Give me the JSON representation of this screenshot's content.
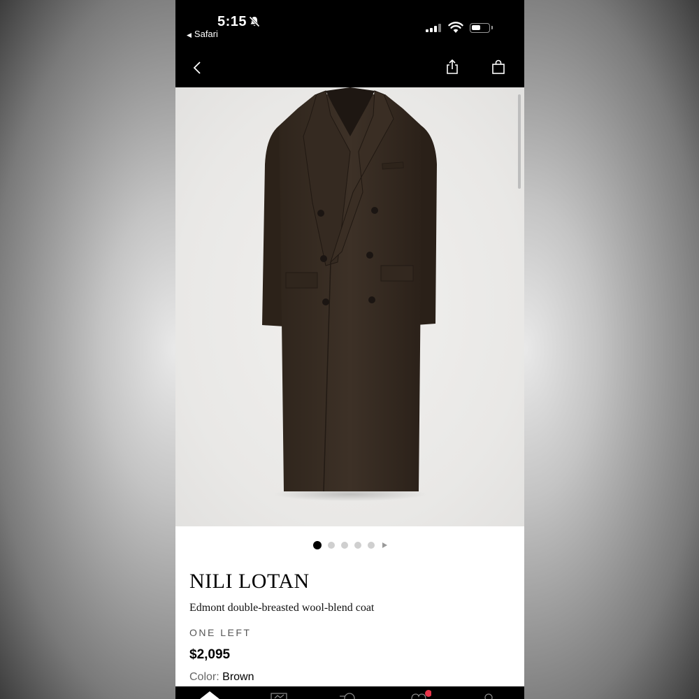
{
  "status_bar": {
    "time": "5:15",
    "back_app_label": "Safari"
  },
  "product": {
    "brand": "NILI LOTAN",
    "name": "Edmont double-breasted wool-blend coat",
    "stock_label": "ONE LEFT",
    "price": "$2,095",
    "color_label": "Color:",
    "color_value": "Brown",
    "coat_color": "#3a2e24"
  },
  "gallery": {
    "pages": 5,
    "active_page": 1
  },
  "icons": {
    "nav_back": "chevron-left-icon",
    "share": "share-icon",
    "bag": "shopping-bag-icon"
  },
  "tab_bar": {
    "notification_color": "#e8354a"
  }
}
